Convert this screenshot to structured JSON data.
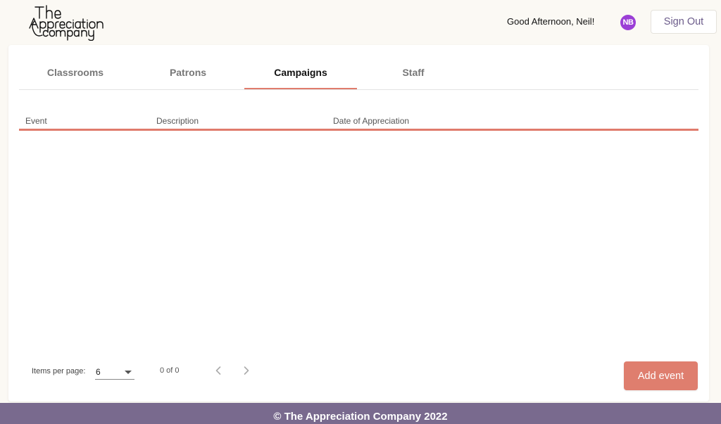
{
  "header": {
    "logo_alt": "The Appreciation Company",
    "greeting": "Good Afternoon, Neil!",
    "avatar_initials": "NB",
    "sign_out_label": "Sign Out"
  },
  "tabs": [
    {
      "label": "Classrooms",
      "active": false
    },
    {
      "label": "Patrons",
      "active": false
    },
    {
      "label": "Campaigns",
      "active": true
    },
    {
      "label": "Staff",
      "active": false
    }
  ],
  "table": {
    "columns": [
      "Event",
      "Description",
      "Date of Appreciation"
    ],
    "rows": []
  },
  "paginator": {
    "items_per_page_label": "Items per page:",
    "items_per_page_value": "6",
    "range_label": "0 of 0"
  },
  "actions": {
    "add_event_label": "Add event"
  },
  "footer": {
    "text": "© The Appreciation Company 2022"
  },
  "colors": {
    "accent": "#df7e6e",
    "footer_bg": "#796a8e",
    "avatar_bg": "#9b3fd6",
    "page_bg": "#fbf9f4"
  }
}
